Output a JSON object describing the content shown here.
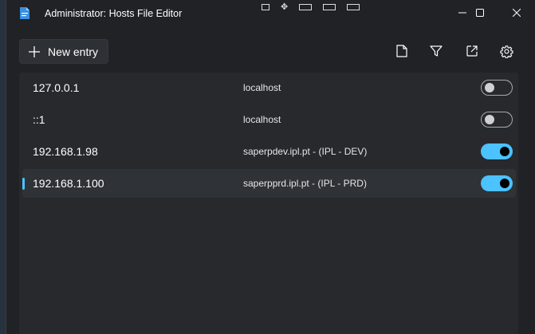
{
  "window": {
    "title": "Administrator: Hosts File Editor"
  },
  "toolbar": {
    "new_entry_label": "New entry",
    "icons": [
      "new-file-icon",
      "filter-icon",
      "open-external-icon",
      "gear-icon"
    ]
  },
  "entries": [
    {
      "ip": "127.0.0.1",
      "host": "localhost",
      "active": false,
      "selected": false
    },
    {
      "ip": "::1",
      "host": "localhost",
      "active": false,
      "selected": false
    },
    {
      "ip": "192.168.1.98",
      "host": "saperpdev.ipl.pt - (IPL - DEV)",
      "active": true,
      "selected": false
    },
    {
      "ip": "192.168.1.100",
      "host": "saperpprd.ipl.pt - (IPL - PRD)",
      "active": true,
      "selected": true
    }
  ],
  "colors": {
    "accent": "#4cc2ff",
    "window_bg": "#202226",
    "list_bg": "#27292d"
  }
}
